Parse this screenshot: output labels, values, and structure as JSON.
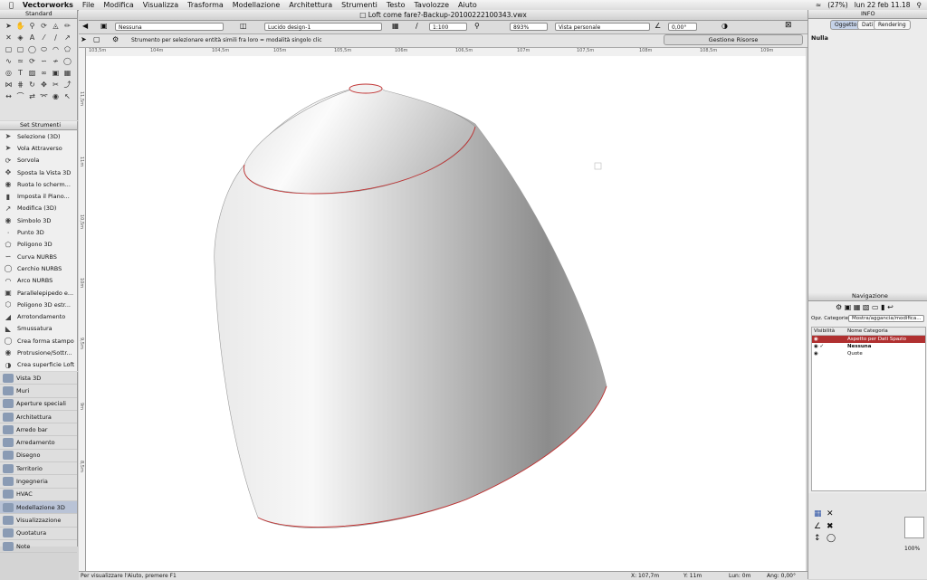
{
  "menubar": {
    "app": "Vectorworks",
    "items": [
      "File",
      "Modifica",
      "Visualizza",
      "Trasforma",
      "Modellazione",
      "Architettura",
      "Strumenti",
      "Testo",
      "Tavolozze",
      "Aiuto"
    ],
    "battery": "(27%)",
    "clock": "lun 22 feb  11.18"
  },
  "palette": {
    "title": "Standard"
  },
  "toolset": {
    "title": "Set Strumenti",
    "items": [
      "Selezione (3D)",
      "Vola Attraverso",
      "Sorvola",
      "Sposta la Vista 3D",
      "Ruota lo scherm...",
      "Imposta il Piano...",
      "Modifica (3D)",
      "Simbolo 3D",
      "Punto 3D",
      "Poligono 3D",
      "Curva NURBS",
      "Cerchio NURBS",
      "Arco NURBS",
      "Parallelepipedo e...",
      "Poligono 3D estr...",
      "Arrotondamento",
      "Smussatura",
      "Crea forma stampo",
      "Protrusione/Sottr...",
      "Crea superficie Loft"
    ],
    "categories": [
      "Vista 3D",
      "Muri",
      "Aperture speciali",
      "Architettura",
      "Arredo bar",
      "Arredamento",
      "Disegno",
      "Territorio",
      "Ingegneria",
      "HVAC",
      "Modellazione 3D",
      "Visualizzazione",
      "Quotatura",
      "Note"
    ]
  },
  "document": {
    "title": "Loft come fare?-Backup-20100222100343.vwx"
  },
  "viewbar": {
    "class": "Nessuna",
    "layer": "Lucido design-1",
    "scale": "1:100",
    "zoom": "893%",
    "view": "Vista personale",
    "angle": "0,00°",
    "resources_button": "Gestione Risorse"
  },
  "modebar": {
    "hint": "Strumento per selezionare entità simili fra loro = modalità singolo clic"
  },
  "ruler": {
    "h_ticks": [
      "103,5m",
      "104m",
      "104,5m",
      "105m",
      "105,5m",
      "106m",
      "106,5m",
      "107m",
      "107,5m",
      "108m",
      "108,5m",
      "109m"
    ],
    "v_ticks": [
      "11,5m",
      "11m",
      "10,5m",
      "10m",
      "9,5m",
      "9m",
      "8,5m"
    ]
  },
  "statusbar": {
    "help": "Per visualizzare l'Aiuto, premere F1",
    "x": "X: 107,7m",
    "y": "Y: 11m",
    "len": "Lun: 0m",
    "ang": "Ang: 0,00°"
  },
  "info": {
    "title": "INFO",
    "tabs": [
      "Oggetto",
      "Dati",
      "Rendering"
    ],
    "selection": "Nulla"
  },
  "navigation": {
    "title": "Navigazione",
    "filter_label": "Opz. Categorie:",
    "filter_value": "Mostra/aggancia/modifica...",
    "col_visibility": "Visibilità",
    "col_name": "Nome Categoria",
    "rows": [
      "Aspetto per Dati Spazio",
      "Nessuna",
      "Quote"
    ]
  },
  "minitools": {
    "zoom": "100%"
  },
  "colors": {
    "accent": "#c5d2e8",
    "sel_row": "#b03030",
    "outline": "#c03030"
  }
}
